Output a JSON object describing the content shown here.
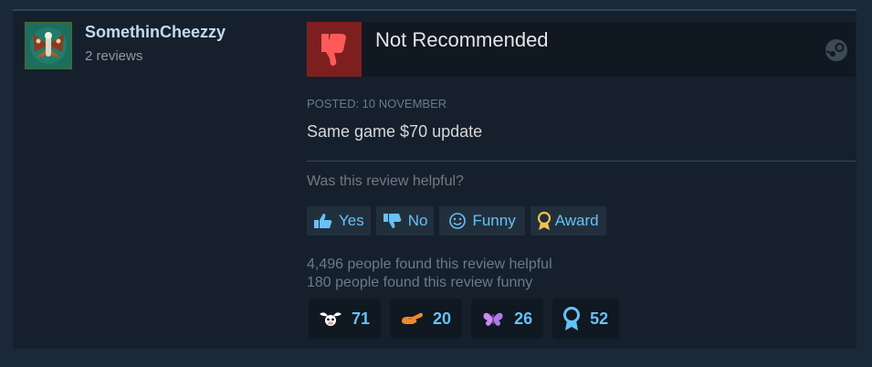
{
  "reviewer": {
    "username": "SomethinCheezzy",
    "review_count": "2 reviews"
  },
  "review": {
    "verdict": "Not Recommended",
    "posted": "POSTED: 10 NOVEMBER",
    "content": "Same game $70 update",
    "verdict_color": "#7e1f1f"
  },
  "helpful": {
    "question": "Was this review helpful?",
    "buttons": [
      {
        "label": "Yes",
        "icon": "thumbs-up-icon"
      },
      {
        "label": "No",
        "icon": "thumbs-down-icon"
      },
      {
        "label": "Funny",
        "icon": "smiley-icon"
      },
      {
        "label": "Award",
        "icon": "award-ribbon-icon"
      }
    ],
    "found_helpful": "4,496 people found this review helpful",
    "found_funny": "180 people found this review funny"
  },
  "awards": [
    {
      "icon": "winged-cow-icon",
      "count": "71"
    },
    {
      "icon": "hand-pointing-icon",
      "count": "20"
    },
    {
      "icon": "butterfly-icon",
      "count": "26"
    },
    {
      "icon": "ribbon-medal-icon",
      "count": "52"
    }
  ],
  "colors": {
    "accent": "#67c1f5",
    "background": "#1b2838",
    "card": "#16202d"
  }
}
